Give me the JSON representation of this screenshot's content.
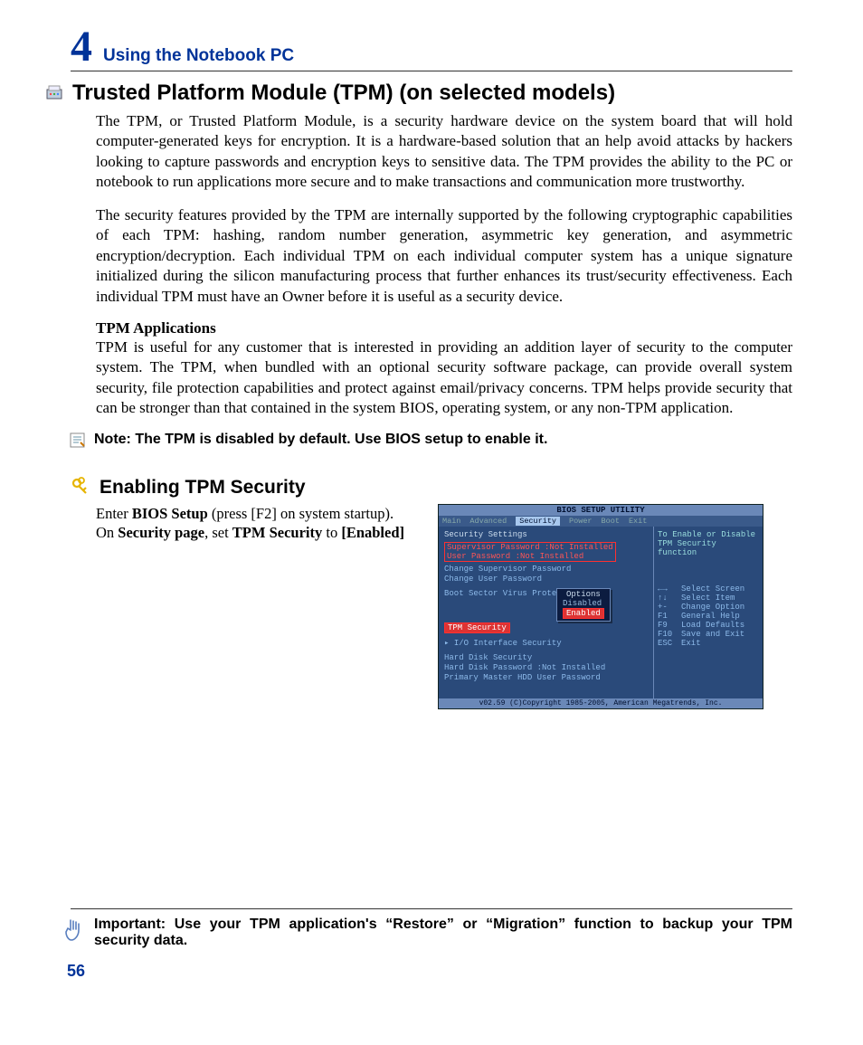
{
  "chapter": {
    "number": "4",
    "title": "Using the Notebook PC"
  },
  "section": {
    "title": "Trusted Platform Module (TPM) (on selected models)",
    "p1": "The TPM, or Trusted Platform Module, is a security hardware device on the system board that will hold computer-generated keys for encryption. It is a hardware-based solution that an help avoid attacks by hackers looking to capture passwords and encryption keys to sensitive data. The TPM provides the ability to the PC or notebook to run applications more secure and to make transactions and communication more trustworthy.",
    "p2": "The security features provided by the TPM are internally supported by the following cryptographic capabilities of each TPM: hashing, random number generation, asymmetric key generation, and asymmetric encryption/decryption. Each individual TPM on each individual computer system has a unique signature initialized during the silicon manufacturing process that further enhances its trust/security effectiveness. Each individual TPM must have an Owner before it is useful as a security device.",
    "apps_heading": "TPM Applications",
    "p3": "TPM is useful for any customer that is interested in providing an addition layer of security to the computer system. The TPM, when bundled with an optional security software package, can provide overall system security, file protection capabilities and protect against email/privacy concerns. TPM helps provide security that can be stronger than that contained in the system BIOS, operating system, or any non-TPM application.",
    "note": "Note: The TPM is disabled by default. Use BIOS setup to enable it."
  },
  "enabling": {
    "heading": "Enabling TPM Security",
    "line1a": "Enter ",
    "line1b": "BIOS Setup",
    "line1c": " (press [F2] on system startup).",
    "line2a": "On ",
    "line2b": "Security page",
    "line2c": ", set ",
    "line2d": "TPM Security",
    "line2e": " to ",
    "line2f": "[Enabled]"
  },
  "bios": {
    "title": "BIOS SETUP UTILITY",
    "tabs": [
      "Main",
      "Advanced",
      "Security",
      "Power",
      "Boot",
      "Exit"
    ],
    "active_tab": "Security",
    "settings_header": "Security Settings",
    "supervisor": "Supervisor Password :Not Installed",
    "user": "User Password      :Not Installed",
    "chg_sup": "Change Supervisor Password",
    "chg_user": "Change User Password",
    "boot_sector": "Boot Sector Virus Protection",
    "options_label": "Options",
    "opt_disabled": "Disabled",
    "opt_enabled": "Enabled",
    "tpm_security": "TPM Security",
    "io_interface": "▸ I/O Interface Security",
    "hard_disk": "Hard Disk Security",
    "hdd_pw": "Hard Disk Password  :Not Installed",
    "primary": "Primary Master HDD User Password",
    "help_text": "To Enable or Disable TPM Security function",
    "keys": [
      [
        "←→",
        "Select Screen"
      ],
      [
        "↑↓",
        "Select Item"
      ],
      [
        "+-",
        "Change Option"
      ],
      [
        "F1",
        "General Help"
      ],
      [
        "F9",
        "Load Defaults"
      ],
      [
        "F10",
        "Save and Exit"
      ],
      [
        "ESC",
        "Exit"
      ]
    ],
    "footer": "v02.59 (C)Copyright 1985-2005, American Megatrends, Inc."
  },
  "important": "Important: Use your TPM application's “Restore” or “Migration” function to backup your TPM security data.",
  "page_number": "56"
}
